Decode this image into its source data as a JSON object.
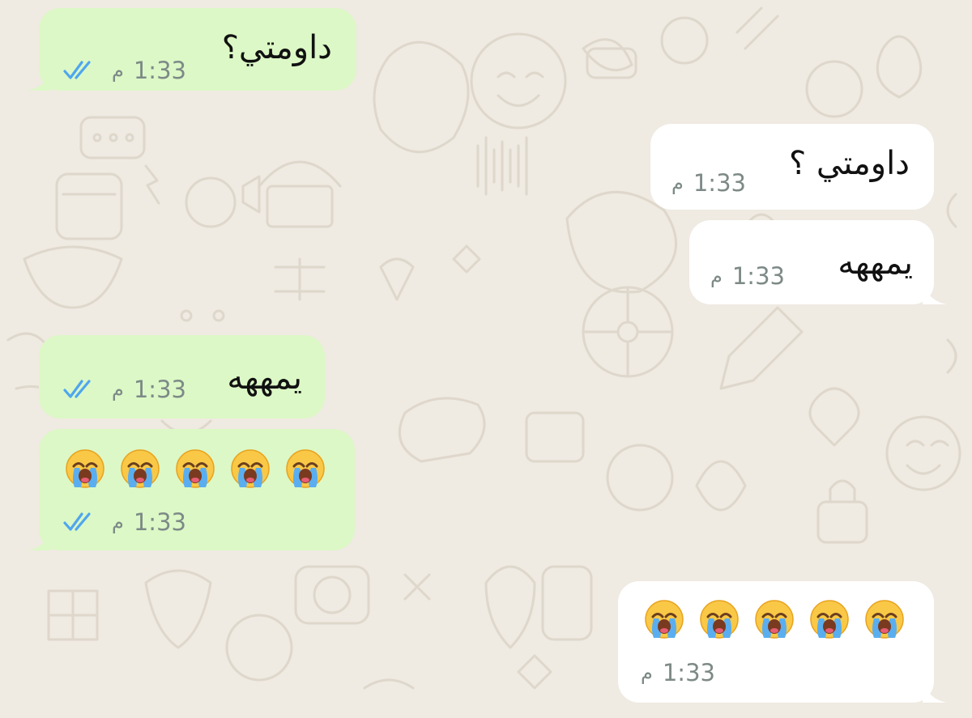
{
  "colors": {
    "background": "#efeae2",
    "outgoing_bubble": "#dcf8c6",
    "incoming_bubble": "#ffffff",
    "timestamp": "#7d8a87",
    "read_ticks": "#4fa6ee"
  },
  "messages": [
    {
      "direction": "outgoing",
      "text": "داومتي؟",
      "time": "1:33",
      "period": "م",
      "status": "read"
    },
    {
      "direction": "incoming",
      "text": "داومتي ؟",
      "time": "1:33",
      "period": "م"
    },
    {
      "direction": "incoming",
      "text": "يمههه",
      "time": "1:33",
      "period": "م"
    },
    {
      "direction": "outgoing",
      "text": "يمههه",
      "time": "1:33",
      "period": "م",
      "status": "read"
    },
    {
      "direction": "outgoing",
      "emoji": [
        "loudly-crying-face",
        "loudly-crying-face",
        "loudly-crying-face",
        "loudly-crying-face",
        "loudly-crying-face"
      ],
      "time": "1:33",
      "period": "م",
      "status": "read"
    },
    {
      "direction": "incoming",
      "emoji": [
        "loudly-crying-face",
        "loudly-crying-face",
        "loudly-crying-face",
        "loudly-crying-face",
        "loudly-crying-face"
      ],
      "time": "1:33",
      "period": "م"
    }
  ]
}
